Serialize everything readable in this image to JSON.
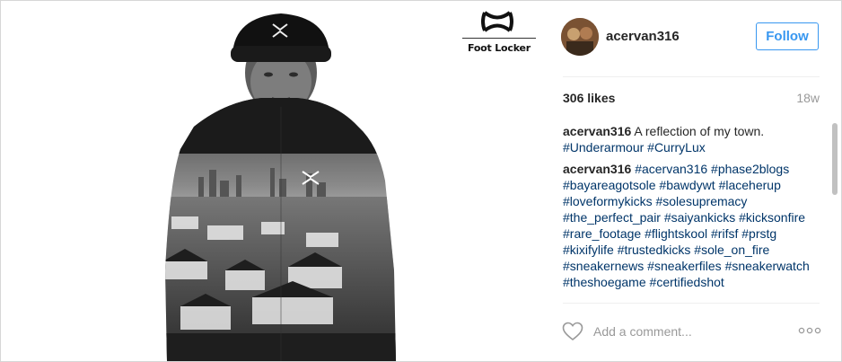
{
  "photo": {
    "brand_logo_text": "Foot Locker"
  },
  "post": {
    "username": "acervan316",
    "follow_label": "Follow",
    "likes": "306 likes",
    "age": "18w"
  },
  "caption": {
    "user": "acervan316",
    "text": "A reflection of my town.",
    "tags": [
      "#Underarmour",
      "#CurryLux"
    ]
  },
  "comment": {
    "user": "acervan316",
    "tags": [
      "#acervan316",
      "#phase2blogs",
      "#bayareagotsole",
      "#bawdywt",
      "#laceherup",
      "#loveformykicks",
      "#solesupremacy",
      "#the_perfect_pair",
      "#saiyankicks",
      "#kicksonfire",
      "#rare_footage",
      "#flightskool",
      "#rifsf",
      "#prstg",
      "#kixifylife",
      "#trustedkicks",
      "#sole_on_fire",
      "#sneakernews",
      "#sneakerfiles",
      "#sneakerwatch",
      "#theshoegame",
      "#certifiedshot"
    ]
  },
  "footer": {
    "comment_placeholder": "Add a comment..."
  },
  "colors": {
    "link": "#003569",
    "follow_blue": "#3897f0",
    "muted": "#999999"
  },
  "icons": [
    "heart-icon",
    "more-options-icon",
    "under-armour-logo"
  ]
}
